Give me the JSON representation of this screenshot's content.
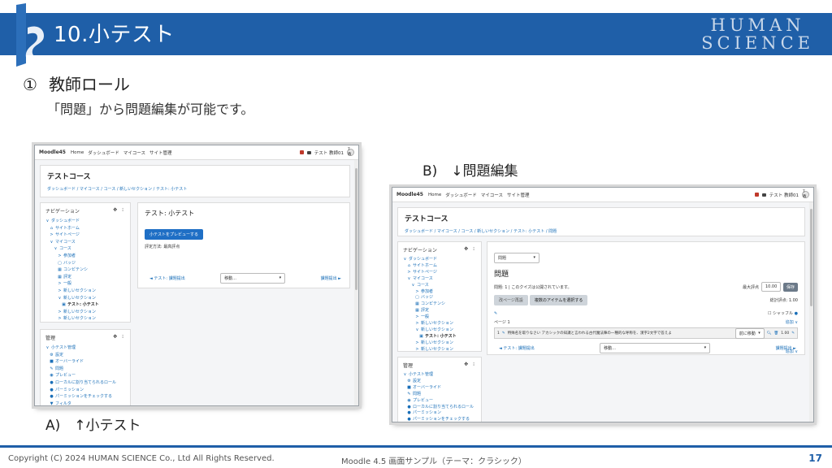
{
  "slide": {
    "title": "10.小テスト",
    "brand_line1": "HUMAN",
    "brand_line2": "SCIENCE",
    "section_number": "①",
    "section_heading": "教師ロール",
    "description": "「問題」から問題編集が可能です。",
    "caption_a": "A)　↑小テスト",
    "caption_b": "B)　↓問題編集"
  },
  "footer": {
    "copyright": "Copyright (C) 2024 HUMAN SCIENCE Co., Ltd All Rights Reserved.",
    "center": "Moodle 4.5 画面サンプル（テーマ：クラシック）",
    "page": "17"
  },
  "colors": {
    "brand_blue": "#1f5fa8",
    "moodle_primary": "#1f6fc5",
    "link": "#1a6fb8"
  },
  "moodle_nav": {
    "site": "Moodle45",
    "items": [
      "Home",
      "ダッシュボード",
      "マイコース",
      "サイト管理"
    ],
    "user": "テスト 教師01",
    "avatar": "T教"
  },
  "course": {
    "title": "テストコース",
    "breadcrumb_a": "ダッシュボード / マイコース / コース / 新しいセクション / テスト: 小テスト",
    "breadcrumb_b": "ダッシュボード / マイコース / コース / 新しいセクション / テスト: 小テスト / 問題"
  },
  "nav_block": {
    "title": "ナビゲーション",
    "items": [
      {
        "label": "ダッシュボード",
        "icon": "∨",
        "indent": 0
      },
      {
        "label": "サイトホーム",
        "icon": "⌂",
        "indent": 1
      },
      {
        "label": "サイトページ",
        "icon": ">",
        "indent": 1
      },
      {
        "label": "マイコース",
        "icon": "∨",
        "indent": 1
      },
      {
        "label": "コース",
        "icon": "∨",
        "indent": 2
      },
      {
        "label": "参加者",
        "icon": ">",
        "indent": 3
      },
      {
        "label": "バッジ",
        "icon": "▢",
        "indent": 3
      },
      {
        "label": "コンピテンシ",
        "icon": "▦",
        "indent": 3
      },
      {
        "label": "評定",
        "icon": "▦",
        "indent": 3
      },
      {
        "label": "一般",
        "icon": ">",
        "indent": 3
      },
      {
        "label": "新しいセクション",
        "icon": ">",
        "indent": 3
      },
      {
        "label": "新しいセクション",
        "icon": "∨",
        "indent": 3
      },
      {
        "label": "テスト: 小テスト",
        "icon": "▣",
        "indent": 4,
        "bold": true
      },
      {
        "label": "新しいセクション",
        "icon": ">",
        "indent": 3
      },
      {
        "label": "新しいセクション",
        "icon": ">",
        "indent": 3
      }
    ]
  },
  "admin_block": {
    "title": "管理",
    "items": [
      {
        "label": "小テスト管理",
        "icon": "∨",
        "indent": 0
      },
      {
        "label": "設定",
        "icon": "⚙",
        "indent": 1
      },
      {
        "label": "オーバーライド",
        "icon": "■",
        "indent": 1
      },
      {
        "label": "問題",
        "icon": "✎",
        "indent": 1
      },
      {
        "label": "プレビュー",
        "icon": "◉",
        "indent": 1
      },
      {
        "label": "ローカルに割り当てられるロール",
        "icon": "●",
        "indent": 1
      },
      {
        "label": "パーミッション",
        "icon": "●",
        "indent": 1
      },
      {
        "label": "パーミッションをチェックする",
        "icon": "●",
        "indent": 1
      },
      {
        "label": "フィルタ",
        "icon": "▼",
        "indent": 1
      }
    ]
  },
  "quiz_main": {
    "title": "テスト: 小テスト",
    "preview_button": "小テストをプレビューする",
    "grading_method": "評定方法: 最高評点",
    "prev_link": "◄ テスト: 課題提出",
    "jump_select": "移動...",
    "next_link": "課題提出 ►"
  },
  "question_edit": {
    "dropdown": "問題",
    "heading": "問題",
    "status": "問題: 1 | このクイズは公開されています。",
    "max_grade_label": "最大評点",
    "max_grade_value": "10.00",
    "save_button": "保存",
    "repaginate_button": "改ページ再設",
    "select_multiple_button": "複数のアイテムを選択する",
    "total_marks": "総計評点: 1.00",
    "shuffle_label": "シャッフル",
    "page_label": "ページ 1",
    "add_label": "追加 ∨",
    "question_text": "特殊名を取りなさい アカシックの知識と言われる古代魔法陣の一種的な呼称を、漢字2文字で答えよ",
    "require_select": "前に移動",
    "question_mark": "1.00",
    "prev_link": "◄ テスト: 課題提出",
    "jump_select": "移動...",
    "next_link": "課題提出 ►"
  }
}
